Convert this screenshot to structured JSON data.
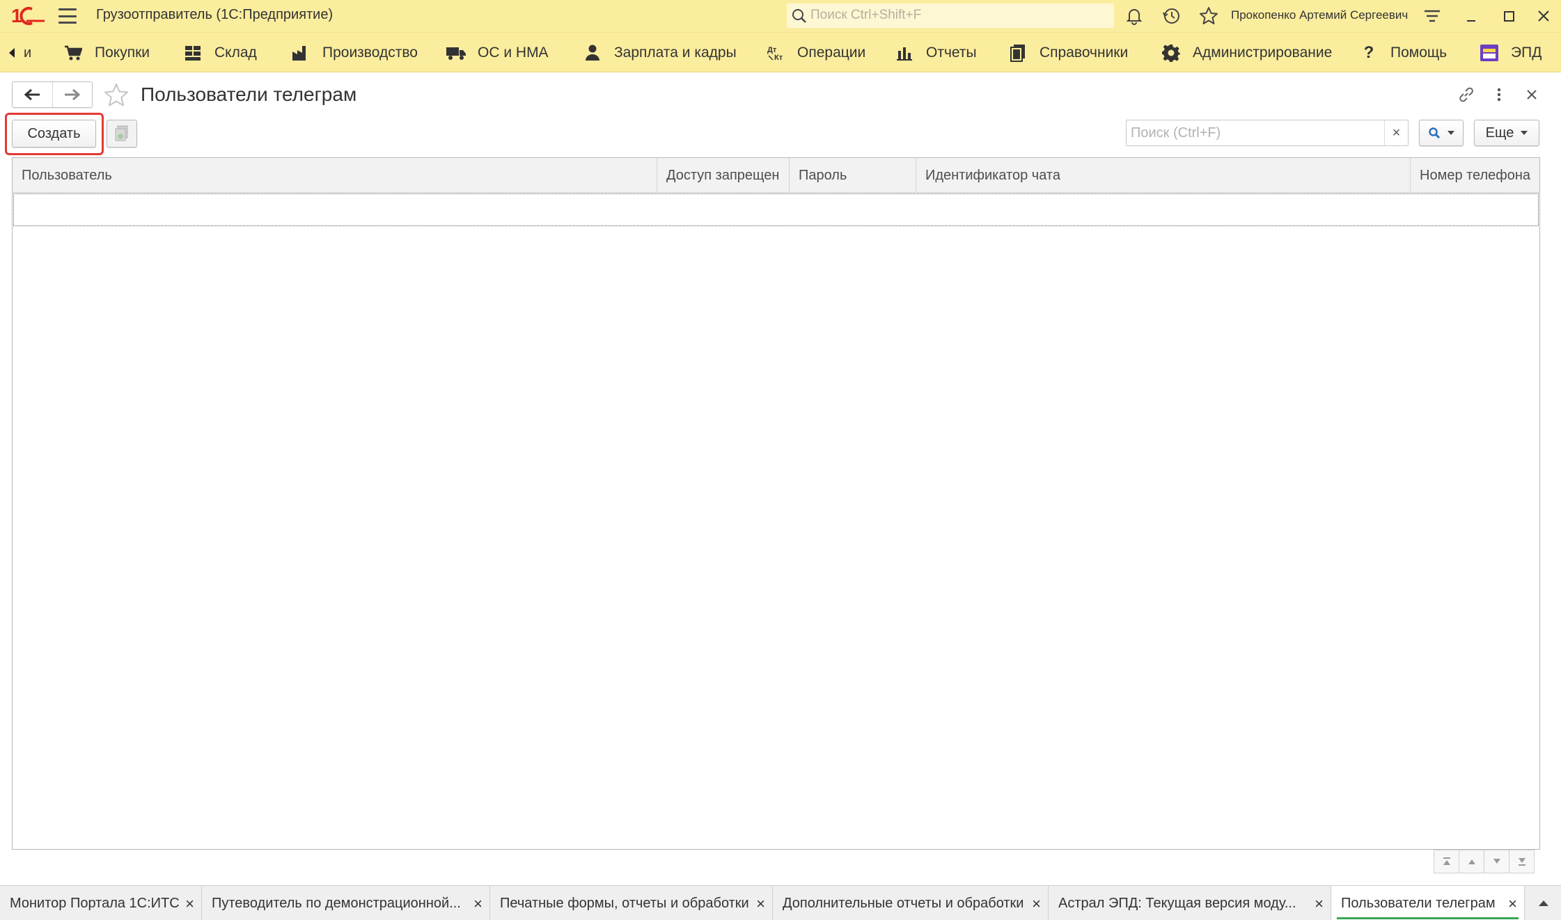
{
  "app": {
    "title": "Грузоотправитель  (1С:Предприятие)",
    "search_placeholder": "Поиск Ctrl+Shift+F",
    "user": "Прокопенко Артемий Сергеевич",
    "brand_color": "#fbed9e"
  },
  "sections": {
    "stub": "и",
    "items": [
      {
        "label": "Покупки",
        "icon": "cart-icon"
      },
      {
        "label": "Склад",
        "icon": "warehouse-icon"
      },
      {
        "label": "Производство",
        "icon": "factory-icon"
      },
      {
        "label": "ОС и НМА",
        "icon": "truck-icon"
      },
      {
        "label": "Зарплата и кадры",
        "icon": "person-icon"
      },
      {
        "label": "Операции",
        "icon": "operations-icon"
      },
      {
        "label": "Отчеты",
        "icon": "bar-chart-icon"
      },
      {
        "label": "Справочники",
        "icon": "books-icon"
      },
      {
        "label": "Администрирование",
        "icon": "gear-icon"
      },
      {
        "label": "Помощь",
        "icon": "question-icon"
      },
      {
        "label": "ЭПД",
        "icon": "epd-icon"
      }
    ]
  },
  "form": {
    "title": "Пользователи телеграм",
    "create_label": "Создать",
    "search_placeholder": "Поиск (Ctrl+F)",
    "clear_label": "×",
    "more_label": "Еще"
  },
  "table": {
    "columns": [
      "Пользователь",
      "Доступ запрещен",
      "Пароль",
      "Идентификатор чата",
      "Номер телефона"
    ],
    "rows": []
  },
  "tabs": [
    {
      "label": "Монитор Портала 1С:ИТС",
      "active": false
    },
    {
      "label": "Путеводитель по демонстрационной...",
      "active": false
    },
    {
      "label": "Печатные формы, отчеты и обработки",
      "active": false
    },
    {
      "label": "Дополнительные отчеты и обработки",
      "active": false
    },
    {
      "label": "Астрал ЭПД: Текущая версия моду...",
      "active": false
    },
    {
      "label": "Пользователи телеграм",
      "active": true
    }
  ],
  "tab_close_label": "×"
}
